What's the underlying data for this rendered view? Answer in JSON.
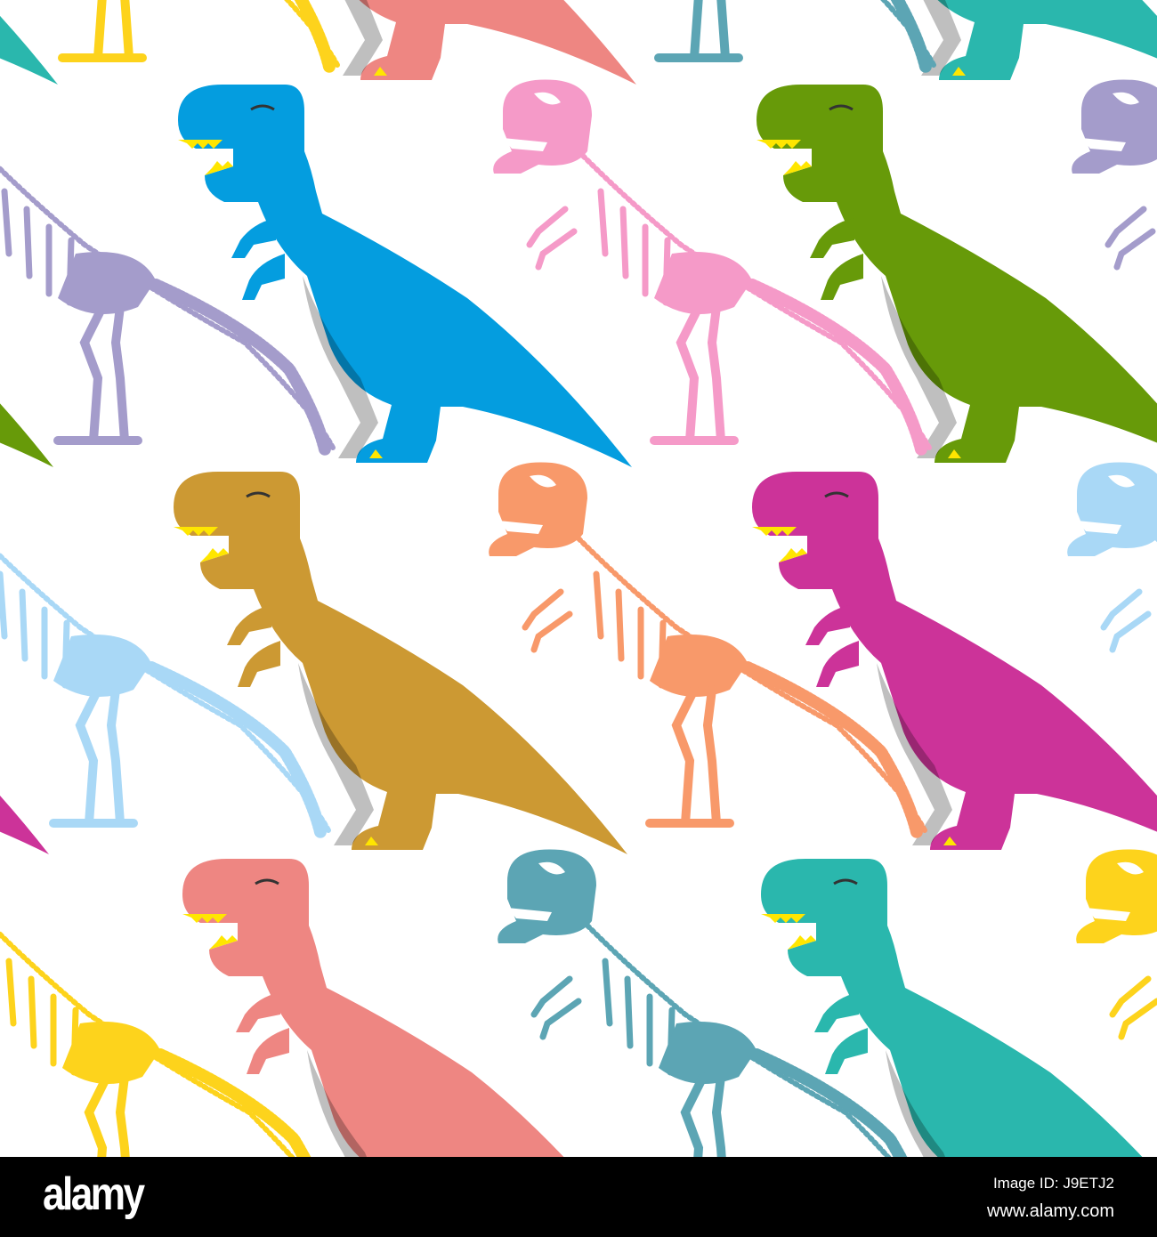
{
  "palette": {
    "blue": "#049ddf",
    "green": "#679a09",
    "brown": "#cc9933",
    "magenta": "#cc3399",
    "salmon": "#ee8682",
    "teal": "#2ab7ad",
    "pink": "#f59ac8",
    "lavender": "#a49ccb",
    "orange": "#f8996a",
    "lightblue": "#a9d8f6",
    "steel": "#5ca5b4",
    "yellow": "#fdd31c",
    "teeth": "#ffe600"
  },
  "footer": {
    "logo": "alamy",
    "image_id": "Image ID: J9ETJ2",
    "site": "www.alamy.com"
  }
}
